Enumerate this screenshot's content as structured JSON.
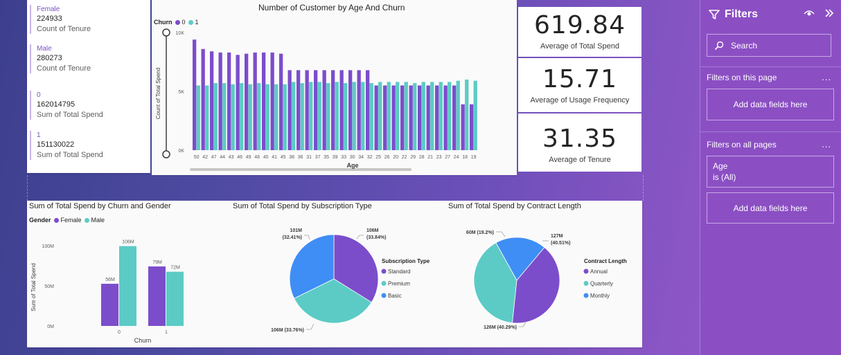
{
  "multi_card": [
    {
      "label": "Female",
      "value": "224933",
      "desc": "Count of Tenure"
    },
    {
      "label": "Male",
      "value": "280273",
      "desc": "Count of Tenure"
    },
    {
      "label": "0",
      "value": "162014795",
      "desc": "Sum of Total Spend"
    },
    {
      "label": "1",
      "value": "151130022",
      "desc": "Sum of Total Spend"
    }
  ],
  "age_chart": {
    "title": "Number of Customer by Age And Churn",
    "legend_title": "Churn",
    "legend": [
      "0",
      "1"
    ],
    "ylabel": "Count of Total Spend",
    "xlabel": "Age",
    "yticks": [
      "10K",
      "5K",
      "0K"
    ]
  },
  "kpis": [
    {
      "value": "619.84",
      "label": "Average of Total Spend"
    },
    {
      "value": "15.71",
      "label": "Average of Usage Frequency"
    },
    {
      "value": "31.35",
      "label": "Average of Tenure"
    }
  ],
  "gender_chart": {
    "title": "Sum of Total Spend by Churn and Gender",
    "legend_title": "Gender",
    "legend": [
      "Female",
      "Male"
    ],
    "ylabel": "Sum of Total Spend",
    "xlabel": "Churn",
    "yticks": [
      "100M",
      "50M",
      "0M"
    ]
  },
  "subscription_chart": {
    "title": "Sum of Total Spend by Subscription Type",
    "legend_title": "Subscription Type",
    "legend": [
      "Standard",
      "Premium",
      "Basic"
    ]
  },
  "contract_chart": {
    "title": "Sum of Total Spend by Contract Length",
    "legend_title": "Contract Length",
    "legend": [
      "Annual",
      "Quarterly",
      "Monthly"
    ]
  },
  "filters": {
    "title": "Filters",
    "search_placeholder": "Search",
    "on_this_page": "Filters on this page",
    "on_all_pages": "Filters on all pages",
    "add_fields": "Add data fields here",
    "age_filter_name": "Age",
    "age_filter_value": "is (All)",
    "more": "..."
  },
  "colors": {
    "purple": "#7c4dcb",
    "teal": "#5ccbc6",
    "blue": "#3f8ef5",
    "filter_pane": "#8b4fc3"
  },
  "chart_data": [
    {
      "type": "bar",
      "title": "Number of Customer by Age And Churn",
      "xlabel": "Age",
      "ylabel": "Count of Total Spend",
      "ylim": [
        0,
        10000
      ],
      "categories": [
        "50",
        "42",
        "47",
        "44",
        "43",
        "46",
        "49",
        "48",
        "40",
        "41",
        "45",
        "38",
        "36",
        "31",
        "37",
        "35",
        "39",
        "33",
        "30",
        "34",
        "32",
        "25",
        "26",
        "20",
        "22",
        "29",
        "28",
        "21",
        "23",
        "27",
        "24",
        "18",
        "19"
      ],
      "series": [
        {
          "name": "0",
          "values": [
            9400,
            8600,
            8400,
            8300,
            8300,
            8100,
            8200,
            8300,
            8300,
            8300,
            8200,
            6800,
            6800,
            6800,
            6800,
            6800,
            6800,
            6800,
            6800,
            6800,
            6800,
            5500,
            5500,
            5500,
            5500,
            5500,
            5500,
            5500,
            5500,
            5500,
            5500,
            3900,
            3900
          ]
        },
        {
          "name": "1",
          "values": [
            5500,
            5500,
            5700,
            5700,
            5600,
            5700,
            5600,
            5700,
            5600,
            5600,
            5600,
            5800,
            5700,
            5800,
            5800,
            5700,
            5800,
            5700,
            5800,
            5800,
            5700,
            5800,
            5800,
            5800,
            5800,
            5700,
            5800,
            5800,
            5800,
            5800,
            5900,
            6000,
            5900
          ]
        }
      ],
      "legend_position": "top-left"
    },
    {
      "type": "bar",
      "title": "Sum of Total Spend by Churn and Gender",
      "xlabel": "Churn",
      "ylabel": "Sum of Total Spend",
      "ylim": [
        0,
        125
      ],
      "categories": [
        "0",
        "1"
      ],
      "series": [
        {
          "name": "Female",
          "values": [
            56,
            79
          ],
          "labels": [
            "56M",
            "79M"
          ]
        },
        {
          "name": "Male",
          "values": [
            106,
            72
          ],
          "labels": [
            "106M",
            "72M"
          ]
        }
      ],
      "legend_position": "top-left"
    },
    {
      "type": "pie",
      "title": "Sum of Total Spend by Subscription Type",
      "labels": [
        "Standard",
        "Premium",
        "Basic"
      ],
      "values": [
        106,
        106,
        101
      ],
      "percents": [
        33.84,
        33.76,
        32.41
      ],
      "data_labels": [
        "106M (33.84%)",
        "106M (33.76%)",
        "101M (32.41%)"
      ],
      "legend_position": "right"
    },
    {
      "type": "pie",
      "title": "Sum of Total Spend by Contract Length",
      "labels": [
        "Annual",
        "Quarterly",
        "Monthly"
      ],
      "values": [
        127,
        126,
        60
      ],
      "percents": [
        40.51,
        40.29,
        19.2
      ],
      "data_labels": [
        "127M (40.51%)",
        "126M (40.29%)",
        "60M (19.2%)"
      ],
      "legend_position": "right"
    }
  ]
}
